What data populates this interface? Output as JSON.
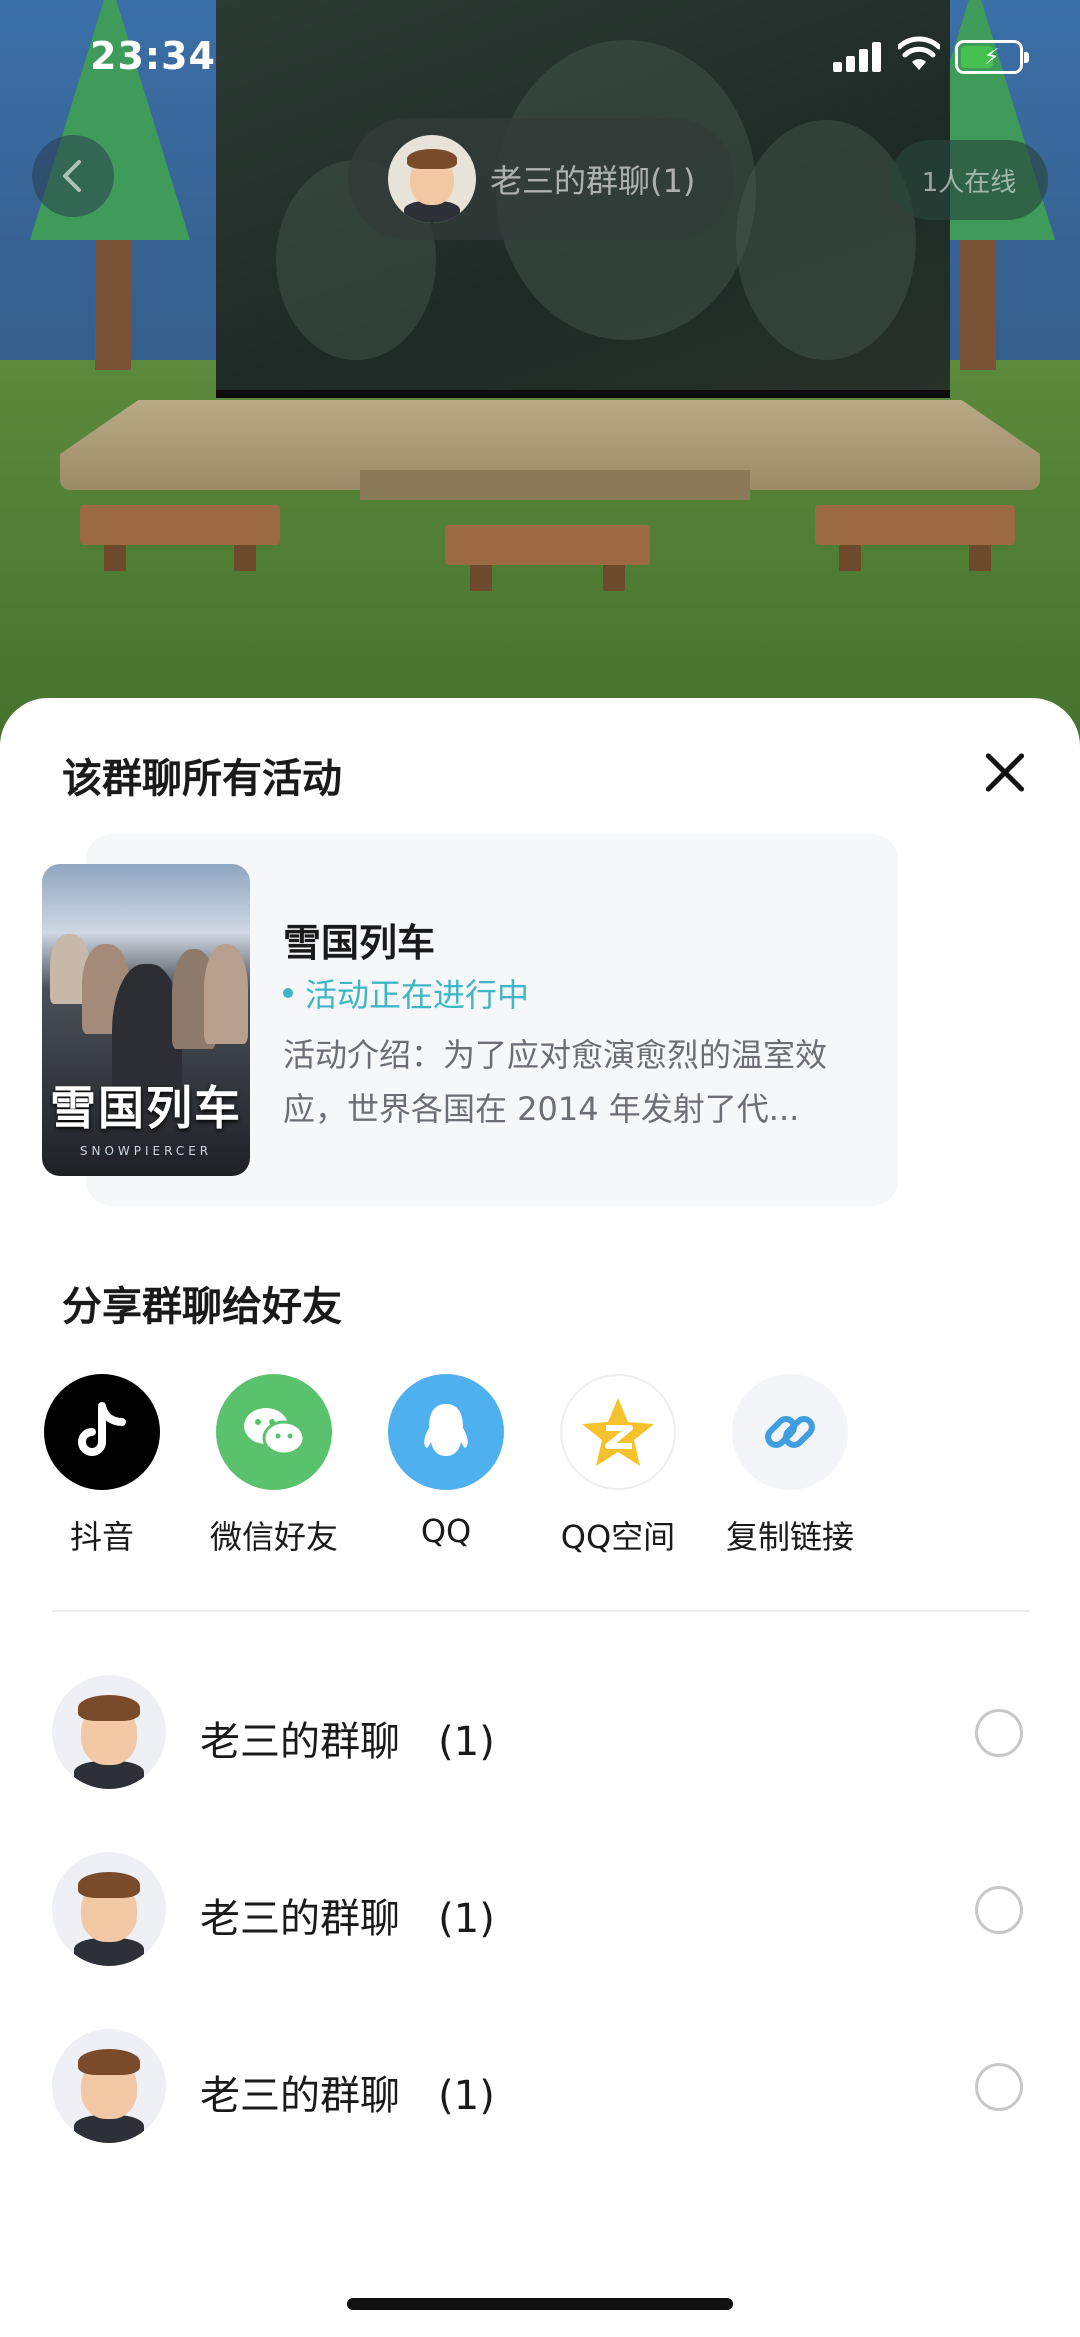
{
  "status_bar": {
    "time": "23:34"
  },
  "room": {
    "title": "老三的群聊(1)",
    "online": "1人在线"
  },
  "sheet": {
    "title": "该群聊所有活动",
    "activity": {
      "name": "雪国列车",
      "status": "活动正在进行中",
      "description": "活动介绍：为了应对愈演愈烈的温室效应，世界各国在 2014 年发射了代...",
      "poster_title": "雪国列车",
      "poster_subtitle": "SNOWPIERCER"
    },
    "share_title": "分享群聊给好友",
    "share_targets": [
      {
        "label": "抖音",
        "icon": "douyin-icon",
        "color": "#000000"
      },
      {
        "label": "微信好友",
        "icon": "wechat-icon",
        "color": "#5ac26c"
      },
      {
        "label": "QQ",
        "icon": "qq-icon",
        "color": "#4fb0f0"
      },
      {
        "label": "QQ空间",
        "icon": "qzone-icon",
        "color": "#ffffff"
      },
      {
        "label": "复制链接",
        "icon": "link-icon",
        "color": "#f3f5f8"
      }
    ],
    "chats": [
      {
        "name": "老三的群聊",
        "count": "(1)",
        "selected": false
      },
      {
        "name": "老三的群聊",
        "count": "(1)",
        "selected": false
      },
      {
        "name": "老三的群聊",
        "count": "(1)",
        "selected": false
      }
    ]
  }
}
